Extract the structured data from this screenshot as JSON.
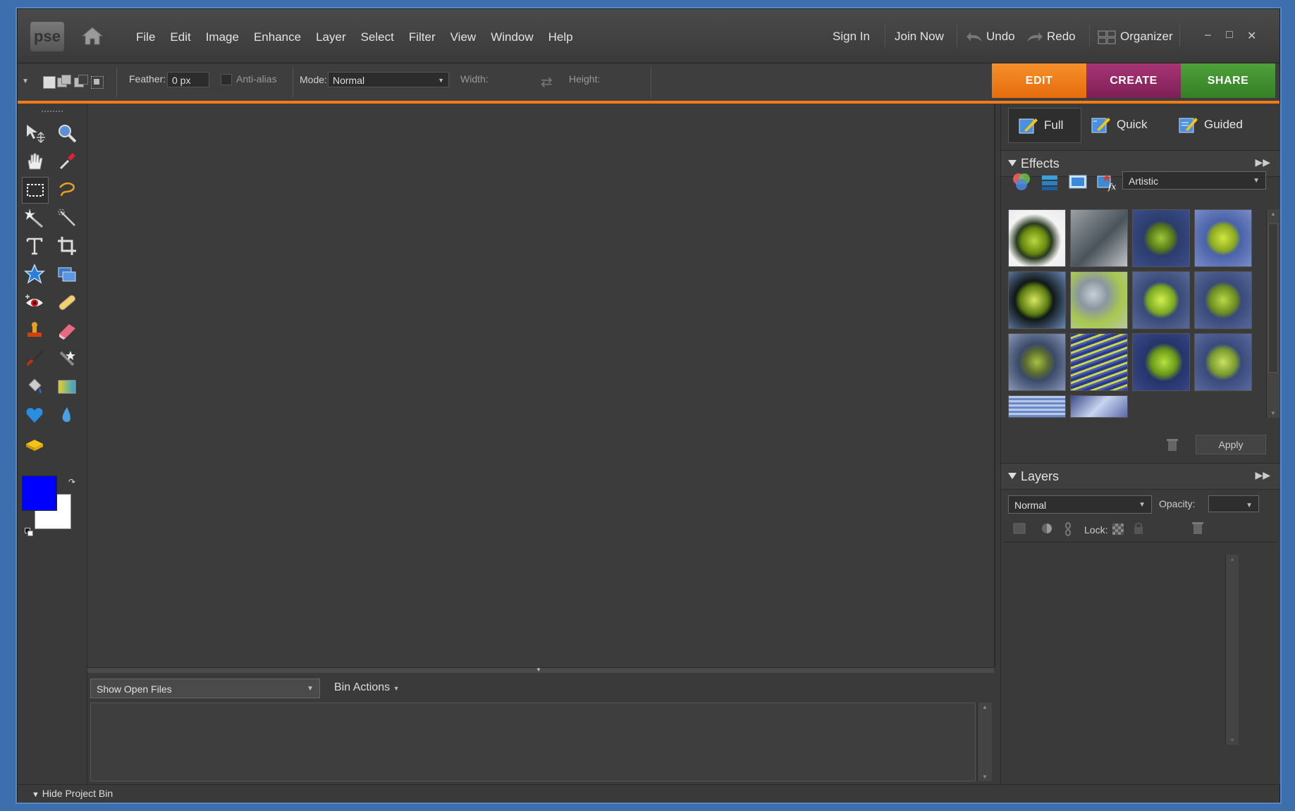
{
  "app": {
    "logo": "pse"
  },
  "menu": [
    "File",
    "Edit",
    "Image",
    "Enhance",
    "Layer",
    "Select",
    "Filter",
    "View",
    "Window",
    "Help"
  ],
  "titlebar": {
    "sign_in": "Sign In",
    "join_now": "Join Now",
    "undo": "Undo",
    "redo": "Redo",
    "organizer": "Organizer"
  },
  "options": {
    "feather_label": "Feather:",
    "feather_value": "0 px",
    "antialias_label": "Anti-alias",
    "mode_label": "Mode:",
    "mode_value": "Normal",
    "width_label": "Width:",
    "height_label": "Height:"
  },
  "workspace_tabs": [
    {
      "label": "EDIT",
      "color": "#f07b17"
    },
    {
      "label": "CREATE",
      "color": "#9b2a6a"
    },
    {
      "label": "SHARE",
      "color": "#3f8f2f"
    }
  ],
  "edit_modes": [
    "Full",
    "Quick",
    "Guided"
  ],
  "effects": {
    "title": "Effects",
    "category": "Artistic",
    "apply": "Apply"
  },
  "layers": {
    "title": "Layers",
    "blend_mode": "Normal",
    "opacity_label": "Opacity:",
    "lock_label": "Lock:"
  },
  "project_bin": {
    "show_select": "Show Open Files",
    "bin_actions": "Bin Actions",
    "hide_label": "Hide Project Bin"
  },
  "colors": {
    "foreground": "#0000ff",
    "background": "#ffffff"
  }
}
